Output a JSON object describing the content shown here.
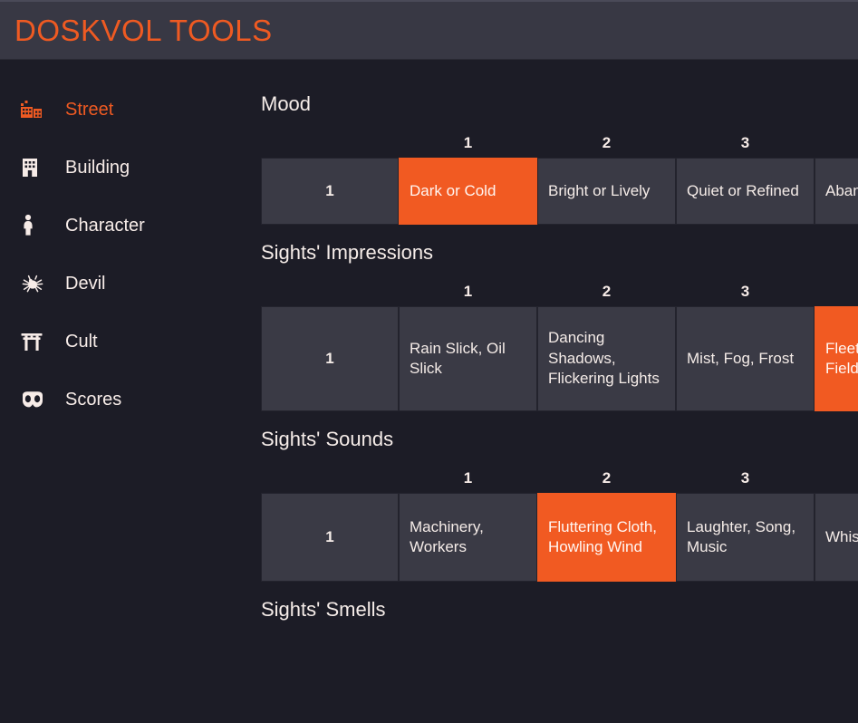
{
  "header": {
    "title": "DOSKVOL TOOLS",
    "accent_color": "#ef5a22",
    "background_color": "#383844"
  },
  "theme": {
    "page_background": "#1c1c26",
    "cell_background": "#3a3a45",
    "selected_background": "#f15a22",
    "text_color": "#f5ece8"
  },
  "sidebar": {
    "items": [
      {
        "label": "Street",
        "icon": "city-buildings-icon",
        "active": true
      },
      {
        "label": "Building",
        "icon": "building-icon",
        "active": false
      },
      {
        "label": "Character",
        "icon": "person-icon",
        "active": false
      },
      {
        "label": "Devil",
        "icon": "spider-icon",
        "active": false
      },
      {
        "label": "Cult",
        "icon": "torii-gate-icon",
        "active": false
      },
      {
        "label": "Scores",
        "icon": "domino-mask-icon",
        "active": false
      }
    ]
  },
  "main": {
    "sections": [
      {
        "title": "Mood",
        "column_headers": [
          "1",
          "2",
          "3"
        ],
        "row_label": "1",
        "cells": [
          {
            "text": "Dark or Cold",
            "selected": true
          },
          {
            "text": "Bright or Lively",
            "selected": false
          },
          {
            "text": "Quiet or Refined",
            "selected": false
          },
          {
            "text": "Aban Decr",
            "selected": false
          }
        ]
      },
      {
        "title": "Sights' Impressions",
        "column_headers": [
          "1",
          "2",
          "3"
        ],
        "row_label": "1",
        "cells": [
          {
            "text": "Rain Slick, Oil Slick",
            "selected": false
          },
          {
            "text": "Dancing Shadows, Flickering Lights",
            "selected": false
          },
          {
            "text": "Mist, Fog, Frost",
            "selected": false
          },
          {
            "text": "Fleet Shap in th Field",
            "selected": true
          }
        ]
      },
      {
        "title": "Sights' Sounds",
        "column_headers": [
          "1",
          "2",
          "3"
        ],
        "row_label": "1",
        "cells": [
          {
            "text": "Machinery, Workers",
            "selected": false
          },
          {
            "text": "Fluttering Cloth, Howling Wind",
            "selected": true
          },
          {
            "text": "Laughter, Song, Music",
            "selected": false
          },
          {
            "text": "Whis Echo Stran",
            "selected": false
          }
        ]
      },
      {
        "title": "Sights' Smells",
        "column_headers": [],
        "row_label": "",
        "cells": []
      }
    ]
  }
}
